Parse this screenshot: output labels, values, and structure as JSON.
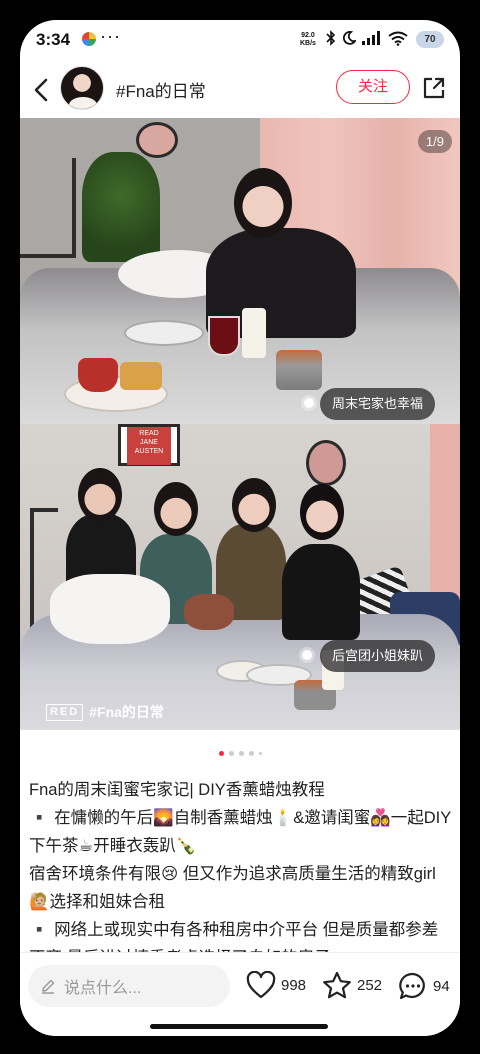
{
  "status_bar": {
    "time": "3:34",
    "dots": "···",
    "speed_value": "92.0",
    "speed_unit": "KB/s",
    "battery": "70"
  },
  "header": {
    "title": "#Fna的日常",
    "follow_label": "关注"
  },
  "gallery": {
    "counter": "1/9",
    "tag1": "周末宅家也幸福",
    "tag2": "后宫团小姐妹趴",
    "poster_lines": [
      "READ",
      "JANE",
      "AUSTEN"
    ],
    "watermark_brand": "RED",
    "watermark_handle": "#Fna的日常",
    "indicator_count": 5,
    "active_index": 0
  },
  "caption": {
    "lines": [
      "Fna的周末闺蜜宅家记| DIY香薰蜡烛教程",
      "▪️ 在慵懒的午后🌄自制香薰蜡烛🕯️&邀请闺蜜👩‍❤️‍👩一起DIY下午茶☕开睡衣轰趴🍾",
      "宿舍环境条件有限😢 但又作为追求高质量生活的精致girl🙋🏼选择和姐妹合租",
      "▪️ 网络上或现实中有各种租房中介平台 但是质量都参差不齐 最后进过慎重考虑选择了自如的房子"
    ]
  },
  "bottom_bar": {
    "comment_placeholder": "说点什么...",
    "likes": "998",
    "stars": "252",
    "comments": "94"
  },
  "colors": {
    "accent": "#ff2442"
  }
}
